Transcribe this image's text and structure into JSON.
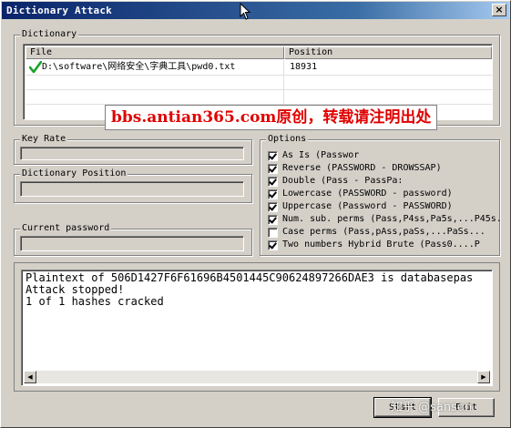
{
  "window": {
    "title": "Dictionary Attack",
    "close_glyph": "×"
  },
  "dictionary": {
    "group_label": "Dictionary",
    "columns": [
      "File",
      "Position"
    ],
    "rows": [
      {
        "file": "D:\\software\\网络安全\\字典工具\\pwd0.txt",
        "position": "18931",
        "checked": true
      }
    ]
  },
  "watermark": "bbs.antian365.com原创，转载请注明出处",
  "key_rate": {
    "label": "Key Rate",
    "value": ""
  },
  "dictionary_position": {
    "label": "Dictionary Position",
    "value": ""
  },
  "current_password": {
    "label": "Current password",
    "value": ""
  },
  "options": {
    "group_label": "Options",
    "items": [
      {
        "label": "As Is (Passwor",
        "checked": true
      },
      {
        "label": "Reverse (PASSWORD - DROWSSAP)",
        "checked": true
      },
      {
        "label": "Double (Pass - PassPa:",
        "checked": true
      },
      {
        "label": "Lowercase (PASSWORD - password)",
        "checked": true
      },
      {
        "label": "Uppercase (Password - PASSWORD)",
        "checked": true
      },
      {
        "label": "Num. sub. perms (Pass,P4ss,Pa5s,...P45s.",
        "checked": true
      },
      {
        "label": "Case perms (Pass,pAss,paSs,...PaSs...",
        "checked": false
      },
      {
        "label": "Two numbers Hybrid Brute (Pass0....P",
        "checked": true
      }
    ]
  },
  "output": {
    "lines": [
      "Plaintext of 506D1427F6F61696B4501445C90624897266DAE3 is databasepas",
      "Attack stopped!",
      "1 of 1 hashes cracked"
    ]
  },
  "buttons": {
    "start": "Start",
    "exit": "Exit"
  },
  "overlay_watermark": "知乎 @sanson",
  "icons": {
    "list_row_status": "green-check-icon",
    "cursor": "arrow-cursor-icon",
    "scroll_left": "scroll-left-arrow-icon",
    "scroll_right": "scroll-right-arrow-icon"
  },
  "colors": {
    "title_gradient_start": "#0a246a",
    "title_gradient_end": "#a6caf0",
    "window_bg": "#d4d0c8",
    "watermark_red": "#e00000",
    "check_green": "#1aa32a"
  }
}
